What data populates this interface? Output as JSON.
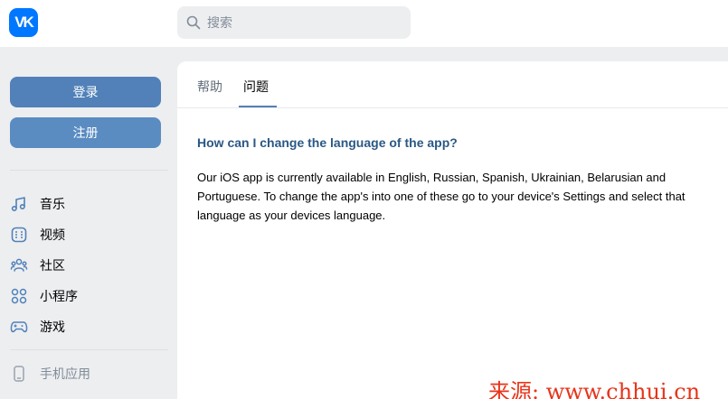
{
  "header": {
    "logo_text": "VK",
    "search_placeholder": "搜索"
  },
  "sidebar": {
    "login_label": "登录",
    "register_label": "注册",
    "items": [
      {
        "icon": "music-icon",
        "label": "音乐"
      },
      {
        "icon": "video-icon",
        "label": "视频"
      },
      {
        "icon": "community-icon",
        "label": "社区"
      },
      {
        "icon": "mini-apps-icon",
        "label": "小程序"
      },
      {
        "icon": "gamepad-icon",
        "label": "游戏"
      }
    ],
    "mobile_app_label": "手机应用"
  },
  "content": {
    "tabs": [
      {
        "label": "帮助",
        "active": false
      },
      {
        "label": "问题",
        "active": true
      }
    ],
    "question_title": "How can I change the language of the app?",
    "answer": "Our iOS app is currently available in English, Russian, Spanish, Ukrainian, Belarusian and Portuguese. To change the app's into one of these go to your device's Settings and select that language as your devices language."
  },
  "watermark": "来源: www.chhui.cn",
  "colors": {
    "brand": "#0077ff",
    "primary_button": "#5181b8",
    "link": "#2a5885",
    "watermark": "#e8341a"
  }
}
